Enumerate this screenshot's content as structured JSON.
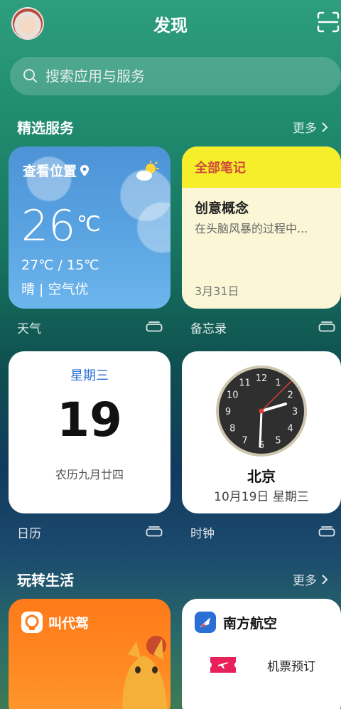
{
  "header": {
    "title": "发现"
  },
  "search": {
    "placeholder": "搜索应用与服务"
  },
  "featured": {
    "title": "精选服务",
    "more": "更多"
  },
  "weather": {
    "location": "查看位置",
    "temp": "26",
    "unit": "℃",
    "range": "27℃ / 15℃",
    "condition": "晴 | 空气优",
    "caption": "天气"
  },
  "memo": {
    "header": "全部笔记",
    "title": "创意概念",
    "preview": "在头脑风暴的过程中...",
    "date": "3月31日",
    "caption": "备忘录"
  },
  "calendar": {
    "weekday": "星期三",
    "day": "19",
    "lunar": "农历九月廿四",
    "caption": "日历"
  },
  "clock": {
    "city": "北京",
    "date": "10月19日 星期三",
    "numbers": [
      "12",
      "1",
      "2",
      "3",
      "4",
      "5",
      "6",
      "7",
      "8",
      "9",
      "10",
      "11"
    ],
    "caption": "时钟"
  },
  "life": {
    "title": "玩转生活",
    "more": "更多"
  },
  "daijia": {
    "label": "叫代驾"
  },
  "airline": {
    "name": "南方航空",
    "item": "机票预订"
  },
  "colors": {
    "accent_yellow": "#f6ee2a",
    "memo_red": "#d04a3a",
    "airline_blue": "#2a6fd6",
    "daijia_orange": "#ff7a1a"
  }
}
